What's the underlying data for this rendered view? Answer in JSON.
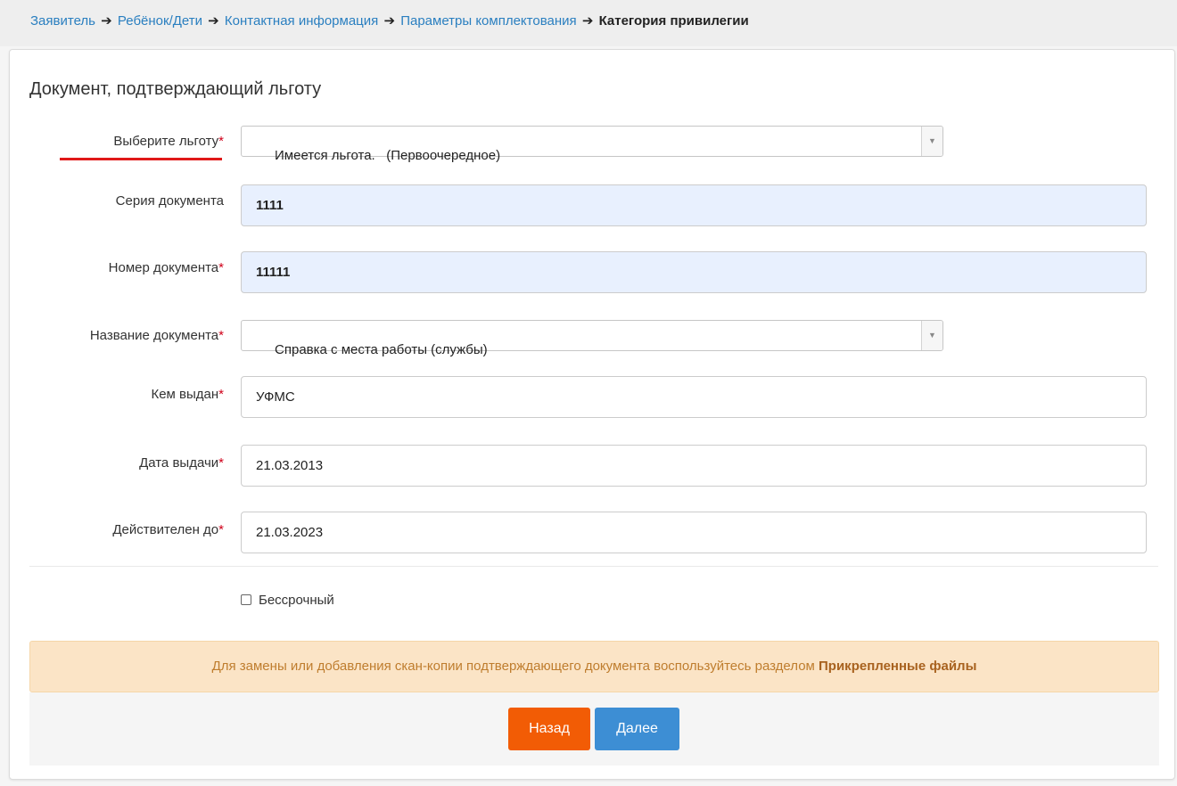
{
  "breadcrumb": {
    "items": [
      "Заявитель",
      "Ребёнок/Дети",
      "Контактная информация",
      "Параметры комплектования"
    ],
    "current": "Категория привилегии",
    "separator": "➔"
  },
  "form": {
    "title": "Документ, подтверждающий льготу",
    "required_mark": "*",
    "fields": {
      "privilege": {
        "label": "Выберите льготу",
        "value": "Имеется льгота.   (Первоочередное)"
      },
      "doc_series": {
        "label": "Серия документа",
        "value": "1111"
      },
      "doc_number": {
        "label": "Номер документа",
        "value": "11111"
      },
      "doc_name": {
        "label": "Название документа",
        "value": "Справка с места работы (службы)"
      },
      "issued_by": {
        "label": "Кем выдан",
        "value": "УФМС"
      },
      "issue_date": {
        "label": "Дата выдачи",
        "value": "21.03.2013"
      },
      "valid_until": {
        "label": "Действителен до",
        "value": "21.03.2023"
      }
    },
    "indefinite_checkbox": {
      "label": "Бессрочный",
      "checked": false
    }
  },
  "alert": {
    "text": "Для замены или добавления скан-копии подтверждающего документа воспользуйтесь разделом ",
    "link_text": "Прикрепленные файлы"
  },
  "buttons": {
    "back": "Назад",
    "next": "Далее"
  },
  "colors": {
    "link": "#2a7fc0",
    "required": "#d0021b",
    "back_button": "#f25c05",
    "next_button": "#3d8ed4",
    "alert_bg": "#fbe4c6",
    "autofill_bg": "#e8f0fe"
  }
}
